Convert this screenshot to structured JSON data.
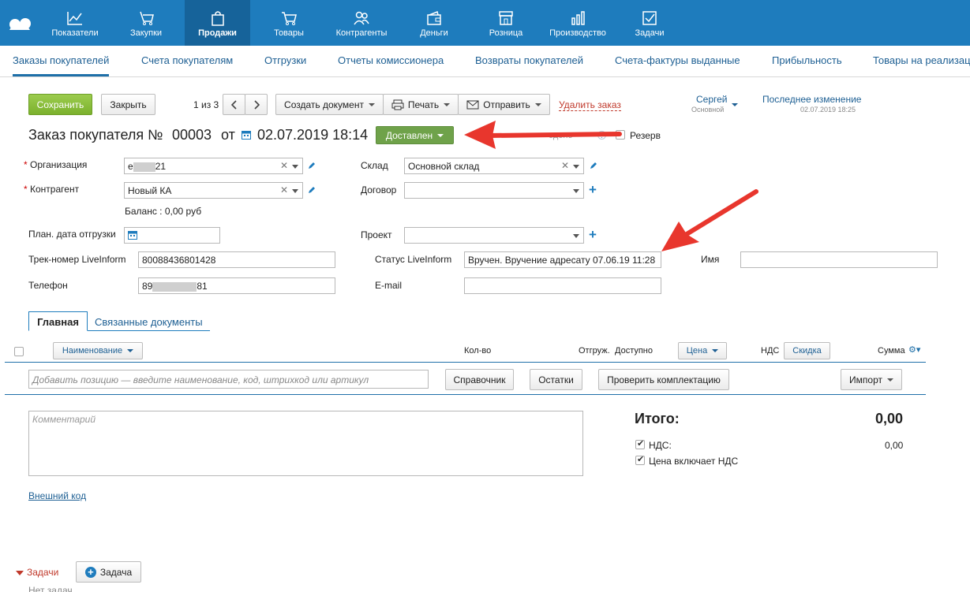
{
  "nav": {
    "items": [
      {
        "label": "Показатели",
        "icon": "chart-line-icon"
      },
      {
        "label": "Закупки",
        "icon": "purchase-icon"
      },
      {
        "label": "Продажи",
        "icon": "shopping-bag-icon"
      },
      {
        "label": "Товары",
        "icon": "cart-icon"
      },
      {
        "label": "Контрагенты",
        "icon": "people-icon"
      },
      {
        "label": "Деньги",
        "icon": "wallet-icon"
      },
      {
        "label": "Розница",
        "icon": "store-icon"
      },
      {
        "label": "Производство",
        "icon": "bar-chart-icon"
      },
      {
        "label": "Задачи",
        "icon": "checkbox-icon"
      }
    ]
  },
  "subnav": {
    "items": [
      "Заказы покупателей",
      "Счета покупателям",
      "Отгрузки",
      "Отчеты комиссионера",
      "Возвраты покупателей",
      "Счета-фактуры выданные",
      "Прибыльность",
      "Товары на реализации"
    ]
  },
  "toolbar": {
    "save": "Сохранить",
    "close": "Закрыть",
    "pager": "1 из 3",
    "create_doc": "Создать документ",
    "print": "Печать",
    "send": "Отправить",
    "delete": "Удалить заказ",
    "user_name": "Сергей",
    "user_role": "Основной",
    "last_change_label": "Последнее изменение",
    "last_change_date": "02.07.2019 18:25"
  },
  "header": {
    "title": "Заказ покупателя №",
    "number": "00003",
    "from": "от",
    "date": "02.07.2019 18:14",
    "status": "Доставлен",
    "partial_text": "едено",
    "help": "?",
    "reserve": "Резерв"
  },
  "form": {
    "org_label": "Организация",
    "org_value_prefix": "е",
    "org_value_suffix": "21",
    "counterparty_label": "Контрагент",
    "counterparty_value": "Новый КА",
    "balance": "Баланс : 0,00 руб",
    "warehouse_label": "Склад",
    "warehouse_value": "Основной склад",
    "contract_label": "Договор",
    "contract_value": "",
    "ship_date_label": "План. дата отгрузки",
    "project_label": "Проект",
    "project_value": "",
    "track_label": "Трек-номер LiveInform",
    "track_value": "80088436801428",
    "status_li_label": "Статус LiveInform",
    "status_li_value": "Вручен. Вручение адресату 07.06.19 11:28",
    "name_label": "Имя",
    "name_value": "",
    "phone_label": "Телефон",
    "phone_prefix": "89",
    "phone_suffix": "81",
    "email_label": "E-mail",
    "email_value": ""
  },
  "tabs": {
    "main": "Главная",
    "related": "Связанные документы"
  },
  "table": {
    "col_name": "Наименование",
    "col_qty": "Кол-во",
    "col_shipped": "Отгруж.",
    "col_available": "Доступно",
    "col_price": "Цена",
    "col_vat": "НДС",
    "col_discount": "Скидка",
    "col_sum": "Сумма",
    "add_placeholder": "Добавить позицию — введите наименование, код, штрихкод или артикул",
    "btn_catalog": "Справочник",
    "btn_stock": "Остатки",
    "btn_check": "Проверить комплектацию",
    "btn_import": "Импорт"
  },
  "footer": {
    "comment_placeholder": "Комментарий",
    "external_code": "Внешний код",
    "total_label": "Итого:",
    "total_value": "0,00",
    "vat_label": "НДС:",
    "vat_value": "0,00",
    "price_incl_vat": "Цена включает НДС",
    "tasks_label": "Задачи",
    "task_button": "Задача",
    "no_tasks": "Нет задач"
  },
  "colors": {
    "nav_bg": "#1e7cbd",
    "nav_active": "#16639a",
    "save_green": "#7bb12d",
    "status_green": "#6fa24a",
    "arrow_red": "#e8362d",
    "link_blue": "#1d5f93"
  }
}
